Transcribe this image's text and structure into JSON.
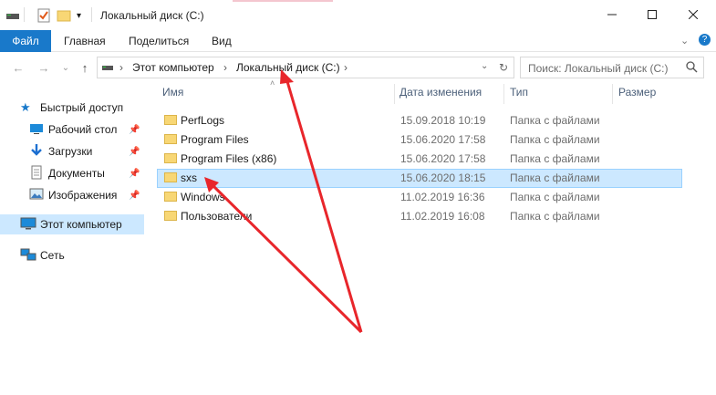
{
  "window": {
    "title": "Локальный диск (C:)"
  },
  "ribbon": {
    "tabs": [
      "Файл",
      "Главная",
      "Поделиться",
      "Вид"
    ]
  },
  "address": {
    "crumbs": [
      "Этот компьютер",
      "Локальный диск (C:)"
    ]
  },
  "search": {
    "placeholder": "Поиск: Локальный диск (C:)"
  },
  "nav": {
    "quick_access": "Быстрый доступ",
    "items": [
      {
        "label": "Рабочий стол",
        "icon": "desktop-icon",
        "pinned": true
      },
      {
        "label": "Загрузки",
        "icon": "downloads-icon",
        "pinned": true
      },
      {
        "label": "Документы",
        "icon": "documents-icon",
        "pinned": true
      },
      {
        "label": "Изображения",
        "icon": "pictures-icon",
        "pinned": true
      }
    ],
    "this_pc": "Этот компьютер",
    "network": "Сеть"
  },
  "columns": {
    "name": "Имя",
    "date": "Дата изменения",
    "type": "Тип",
    "size": "Размер"
  },
  "files": [
    {
      "name": "PerfLogs",
      "date": "15.09.2018 10:19",
      "type": "Папка с файлами"
    },
    {
      "name": "Program Files",
      "date": "15.06.2020 17:58",
      "type": "Папка с файлами"
    },
    {
      "name": "Program Files (x86)",
      "date": "15.06.2020 17:58",
      "type": "Папка с файлами"
    },
    {
      "name": "sxs",
      "date": "15.06.2020 18:15",
      "type": "Папка с файлами"
    },
    {
      "name": "Windows",
      "date": "11.02.2019 16:36",
      "type": "Папка с файлами"
    },
    {
      "name": "Пользователи",
      "date": "11.02.2019 16:08",
      "type": "Папка с файлами"
    }
  ],
  "selected_row": 3,
  "colors": {
    "accent": "#1979ca",
    "selection": "#cce8ff",
    "annotation": "#e8262b"
  }
}
